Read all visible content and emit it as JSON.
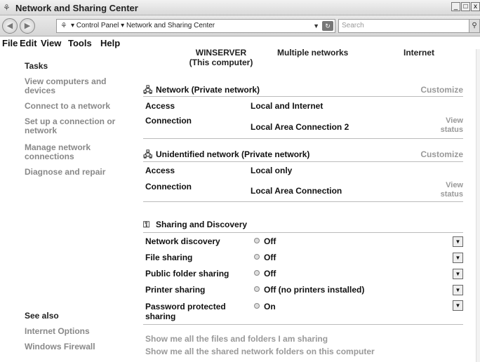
{
  "window": {
    "title": "Network and Sharing Center",
    "controls": [
      "_",
      "□",
      "x"
    ]
  },
  "address": {
    "breadcrumb": "▾ Control Panel ▾ Network and Sharing Center",
    "search_placeholder": "Search"
  },
  "menu": [
    "File",
    "Edit",
    "View",
    "Tools",
    "Help"
  ],
  "sidebar": {
    "tasks_heading": "Tasks",
    "tasks": [
      "View computers and devices",
      "Connect to a network",
      "Set up a connection or network",
      "Manage network connections",
      "Diagnose and repair"
    ],
    "see_also_heading": "See also",
    "see_also": [
      "Internet Options",
      "Windows Firewall"
    ]
  },
  "map": {
    "computer": "WINSERVER",
    "computer_sub": "(This computer)",
    "middle": "Multiple networks",
    "internet": "Internet"
  },
  "networks": [
    {
      "name": "Network (Private network)",
      "customize": "Customize",
      "access_label": "Access",
      "access": "Local and Internet",
      "connection_label": "Connection",
      "connection": "Local Area Connection 2",
      "view_status": "View status"
    },
    {
      "name": "Unidentified network (Private network)",
      "customize": "Customize",
      "access_label": "Access",
      "access": "Local only",
      "connection_label": "Connection",
      "connection": "Local Area Connection",
      "view_status": "View status"
    }
  ],
  "sharing": {
    "heading": "Sharing and Discovery",
    "rows": [
      {
        "label": "Network discovery",
        "value": "Off"
      },
      {
        "label": "File sharing",
        "value": "Off"
      },
      {
        "label": "Public folder sharing",
        "value": "Off"
      },
      {
        "label": "Printer sharing",
        "value": "Off (no printers installed)"
      },
      {
        "label": "Password protected sharing",
        "value": "On"
      }
    ],
    "links": [
      "Show me all the files and folders I am sharing",
      "Show me all the shared network folders on this computer"
    ]
  }
}
